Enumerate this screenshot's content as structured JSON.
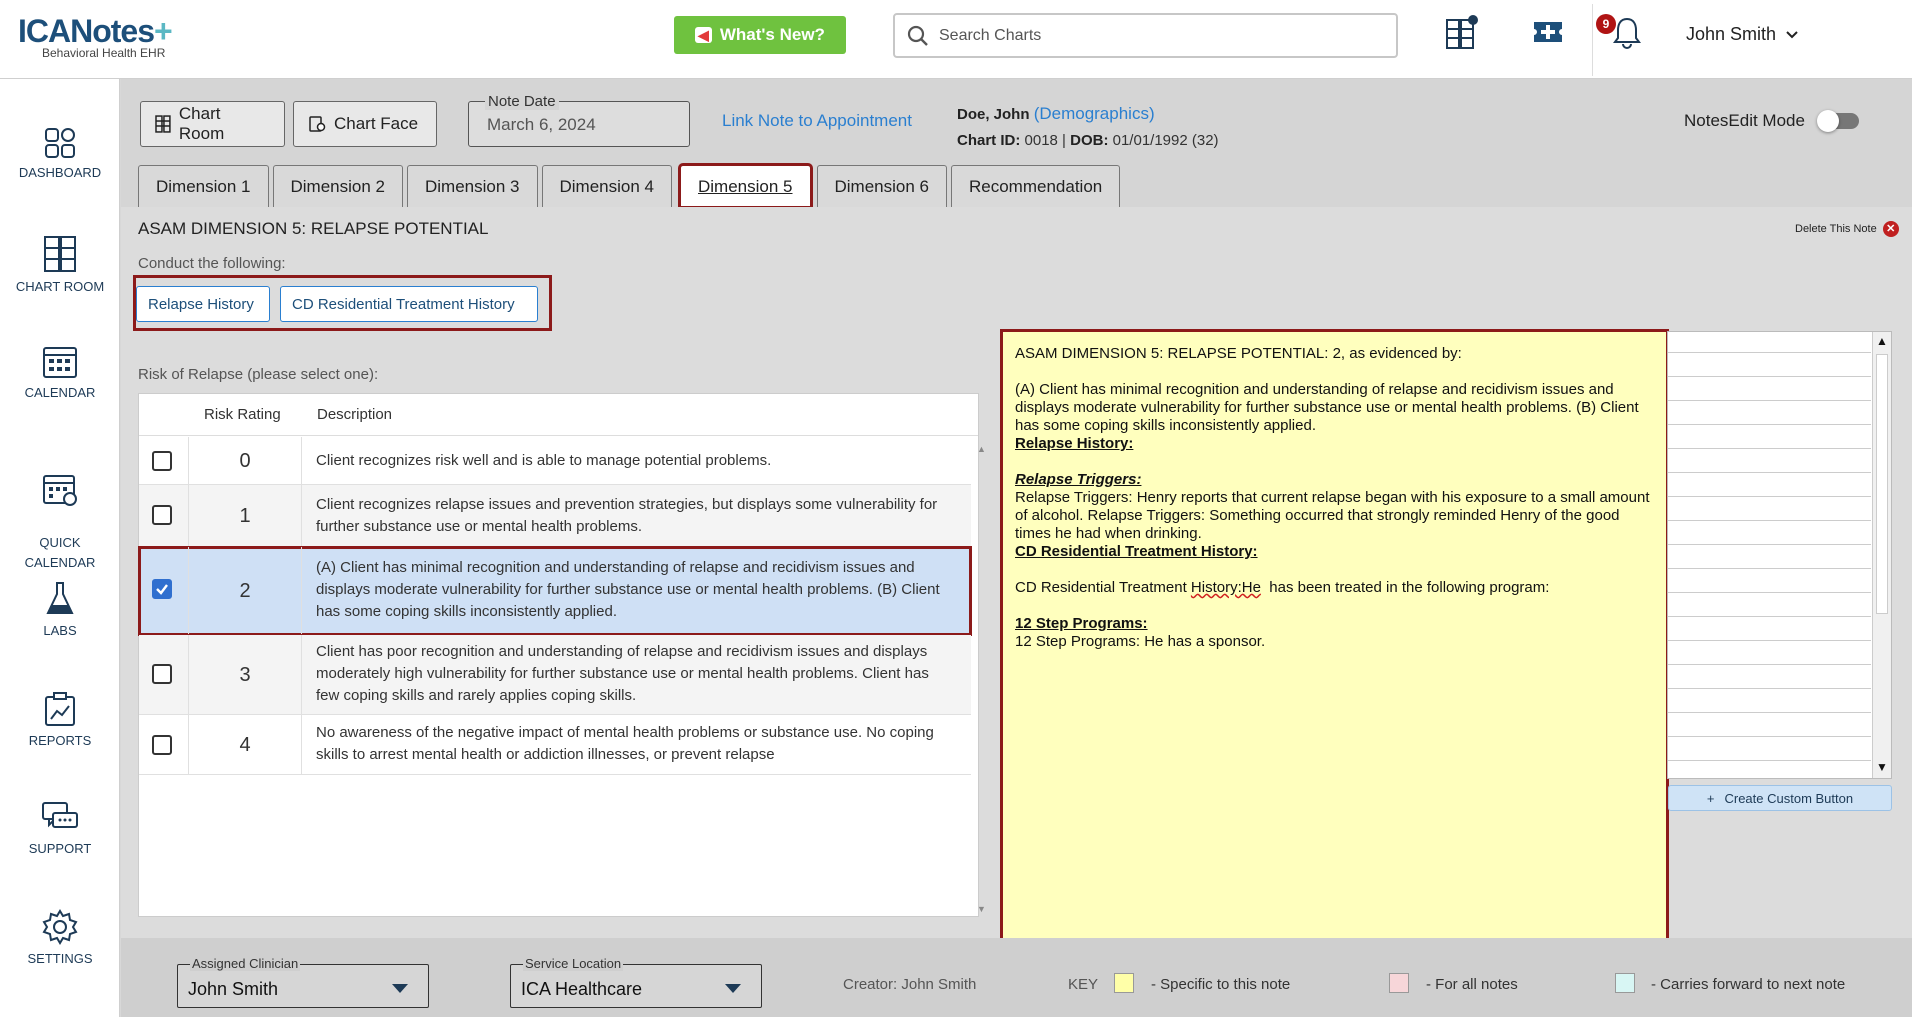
{
  "app": {
    "logo": "ICANotes",
    "logo_sub": "Behavioral Health EHR",
    "whats_new": "What's New?",
    "search_placeholder": "Search Charts",
    "notification_count": "9",
    "user_name": "John Smith"
  },
  "nav": [
    {
      "label": "DASHBOARD",
      "icon": "dashboard-icon"
    },
    {
      "label": "CHART ROOM",
      "icon": "chart-room-icon"
    },
    {
      "label": "CALENDAR",
      "icon": "calendar-icon"
    },
    {
      "label": "QUICK\nCALENDAR",
      "icon": "quick-calendar-icon"
    },
    {
      "label": "LABS",
      "icon": "labs-icon"
    },
    {
      "label": "REPORTS",
      "icon": "reports-icon"
    },
    {
      "label": "SUPPORT",
      "icon": "support-icon"
    },
    {
      "label": "SETTINGS",
      "icon": "gear-icon"
    }
  ],
  "header": {
    "chart_room_btn": "Chart Room",
    "chart_face_btn": "Chart Face",
    "note_date_label": "Note Date",
    "note_date_value": "March 6, 2024",
    "link_appt": "Link Note to Appointment",
    "patient_name": "Doe, John",
    "demographics": "(Demographics)",
    "chart_id_label": "Chart ID:",
    "chart_id": "0018",
    "dob_label": "DOB:",
    "dob": "01/01/1992 (32)",
    "edit_mode": "NotesEdit Mode"
  },
  "tabs": [
    {
      "label": "Dimension 1",
      "active": false
    },
    {
      "label": "Dimension 2",
      "active": false
    },
    {
      "label": "Dimension 3",
      "active": false
    },
    {
      "label": "Dimension 4",
      "active": false
    },
    {
      "label": "Dimension 5",
      "active": true
    },
    {
      "label": "Dimension 6",
      "active": false
    },
    {
      "label": "Recommendation",
      "active": false
    }
  ],
  "panel": {
    "title": "ASAM DIMENSION 5: RELAPSE POTENTIAL",
    "delete_note": "Delete This Note",
    "conduct_label": "Conduct the following:",
    "relapse_history_btn": "Relapse History",
    "cd_history_btn": "CD Residential Treatment History",
    "risk_label": "Risk of Relapse (please select one):",
    "col_rating": "Risk Rating",
    "col_desc": "Description",
    "rows": [
      {
        "rating": "0",
        "checked": false,
        "desc": "Client recognizes risk well and is able to manage potential problems."
      },
      {
        "rating": "1",
        "checked": false,
        "desc": "Client recognizes relapse issues and prevention strategies, but displays some vulnerability for further substance use or mental health problems."
      },
      {
        "rating": "2",
        "checked": true,
        "desc": "(A) Client has minimal recognition and understanding of relapse and recidivism issues and displays moderate vulnerability for further substance use or mental health problems. (B) Client has some coping skills inconsistently applied."
      },
      {
        "rating": "3",
        "checked": false,
        "desc": "Client has poor recognition and understanding of relapse and recidivism issues and displays moderately high vulnerability for further substance use or mental health problems. Client has few coping skills and rarely applies coping skills."
      },
      {
        "rating": "4",
        "checked": false,
        "desc": "No awareness of the negative impact of mental health problems or substance use. No coping skills to arrest mental health or addiction illnesses, or prevent relapse"
      }
    ]
  },
  "note": {
    "line1": "ASAM DIMENSION 5: RELAPSE POTENTIAL: 2, as evidenced by:",
    "line2": "(A) Client has minimal recognition and understanding of relapse and recidivism issues and displays moderate vulnerability for further substance use or mental health problems. (B) Client has some coping skills inconsistently applied.",
    "relapse_history_hd": "Relapse History:",
    "relapse_triggers_hd": "Relapse Triggers:",
    "relapse_triggers_text": "Relapse Triggers: Henry reports that current relapse began with his exposure to a small amount of alcohol. Relapse Triggers: Something occurred that strongly reminded Henry of the good times he had when drinking.",
    "cd_hd": "CD Residential Treatment History:",
    "cd_text_a": "CD Residential Treatment ",
    "cd_text_b": "History:He",
    "cd_text_c": "  has been treated in the following program:",
    "step_hd": "12 Step Programs:",
    "step_text": "12 Step Programs: He has a sponsor."
  },
  "custom": {
    "create_btn": "Create Custom Button"
  },
  "footer": {
    "clinician_label": "Assigned Clinician",
    "clinician": "John Smith",
    "location_label": "Service Location",
    "location": "ICA Healthcare",
    "creator": "Creator: John Smith",
    "key": "KEY",
    "key_specific": "- Specific to this note",
    "key_all": "- For all notes",
    "key_carry": "- Carries forward to next note",
    "color_specific": "#ffffa8",
    "color_all": "#f7d6d9",
    "color_carry": "#d8f6f4"
  }
}
